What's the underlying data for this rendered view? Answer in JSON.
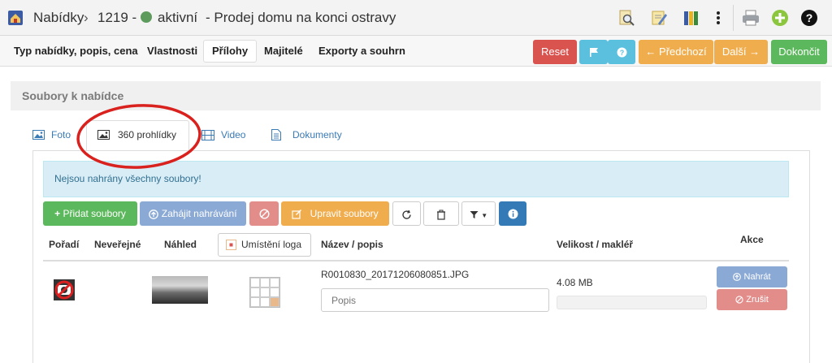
{
  "breadcrumb": {
    "offers": "Nabídky",
    "id": "1219 -",
    "status": "aktivní",
    "title": "- Prodej domu na konci ostravy"
  },
  "steps": [
    {
      "label": "Typ nabídky, popis, cena"
    },
    {
      "label": "Vlastnosti"
    },
    {
      "label": "Přílohy"
    },
    {
      "label": "Majitelé"
    },
    {
      "label": "Exporty a souhrn"
    }
  ],
  "actions": {
    "reset": "Reset",
    "previous": "Předchozí",
    "next": "Další",
    "finish": "Dokončit"
  },
  "panel": {
    "title": "Soubory k nabídce"
  },
  "tabs": [
    {
      "label": "Foto"
    },
    {
      "label": "360 prohlídky"
    },
    {
      "label": "Video"
    },
    {
      "label": "Dokumenty"
    }
  ],
  "alert": "Nejsou nahrány všechny soubory!",
  "toolbar": {
    "add_files": "Přidat soubory",
    "start_upload": "Zahájit nahrávání",
    "edit_files": "Upravit soubory"
  },
  "table": {
    "headers": {
      "order": "Pořadí",
      "private": "Neveřejné",
      "preview": "Náhled",
      "logo_position": "Umístění loga",
      "name": "Název / popis",
      "size": "Velikost / makléř",
      "actions": "Akce"
    },
    "rows": [
      {
        "filename": "R0010830_20171206080851.JPG",
        "description_placeholder": "Popis",
        "size": "4.08 MB",
        "upload_label": "Nahrát",
        "cancel_label": "Zrušit"
      }
    ]
  },
  "colors": {
    "reset": "#d9534f",
    "info": "#5bc0de",
    "warning": "#f0ad4e",
    "success": "#5cb85c",
    "primary": "#337ab7",
    "status_dot": "#5c9b5c",
    "annotation": "#d9211e"
  }
}
